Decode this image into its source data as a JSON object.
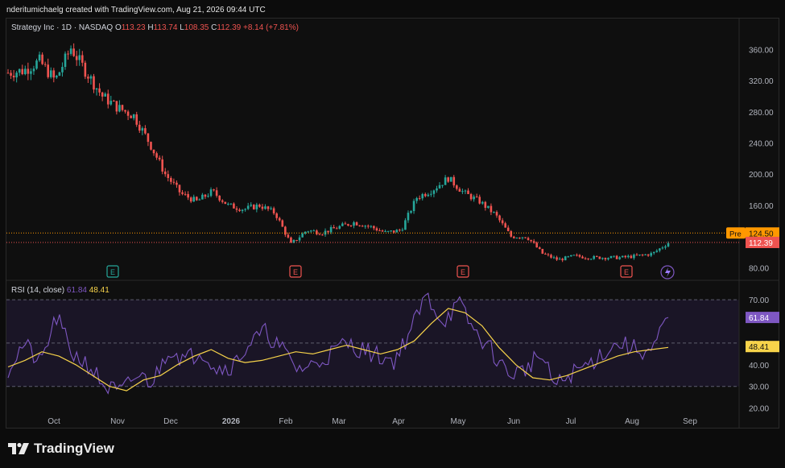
{
  "header": {
    "credit": "nderitumichaelg created with TradingView.com, Aug 21, 2026 09:44 UTC"
  },
  "legend": {
    "symbol": "Strategy Inc · 1D · NASDAQ",
    "o_label": "O",
    "o": "113.23",
    "h_label": "H",
    "h": "113.74",
    "l_label": "L",
    "l": "108.35",
    "c_label": "C",
    "c": "112.39",
    "change": "+8.14 (+7.81%)",
    "rsi_label": "RSI (14, close)",
    "rsi_value": "61.84",
    "rsi_ma": "48.41"
  },
  "price_axis": {
    "ticks": [
      "360.00",
      "320.00",
      "280.00",
      "240.00",
      "200.00",
      "160.00",
      "80.00"
    ]
  },
  "price_tags": {
    "pre_label": "Pre",
    "pre_value": "124.50",
    "last_value": "112.39"
  },
  "rsi_axis": {
    "ticks": [
      "70.00",
      "50.00",
      "40.00",
      "30.00",
      "20.00"
    ],
    "rsi_tag": "61.84",
    "ma_tag": "48.41"
  },
  "x_axis": {
    "ticks": [
      "Oct",
      "Nov",
      "Dec",
      "2026",
      "Feb",
      "Mar",
      "Apr",
      "May",
      "Jun",
      "Jul",
      "Aug",
      "Sep"
    ]
  },
  "events": {
    "label": "E"
  },
  "colors": {
    "up": "#26a69a",
    "down": "#ef5350",
    "rsi": "#7e57c2",
    "rsi_ma": "#f7d34a",
    "pre": "#ff9800"
  },
  "chart_data": {
    "type": "candlestick",
    "title": "Strategy Inc · 1D · NASDAQ",
    "ylim": [
      70,
      380
    ],
    "price_anchors_x": [
      "Sep 12",
      "Sep 20",
      "Sep 28",
      "Oct 1",
      "Oct 5",
      "Oct 12",
      "Oct 20",
      "Oct 28",
      "Nov 5",
      "Nov 12",
      "Nov 20",
      "Nov 28",
      "Dec 5",
      "Dec 15",
      "Dec 25",
      "Jan 5",
      "Jan 15",
      "Jan 25",
      "Feb 1",
      "Feb 5",
      "Feb 15",
      "Feb 25",
      "Mar 5",
      "Mar 15",
      "Mar 25",
      "Apr 1",
      "Apr 10",
      "Apr 20",
      "Apr 28",
      "May 5",
      "May 12",
      "May 20",
      "May 28",
      "Jun 5",
      "Jun 12",
      "Jun 20",
      "Jun 25",
      "Jul 5",
      "Jul 15",
      "Jul 25",
      "Aug 5",
      "Aug 15",
      "Aug 20"
    ],
    "price_anchors_y": [
      330,
      333,
      345,
      320,
      362,
      330,
      300,
      285,
      275,
      240,
      200,
      175,
      165,
      178,
      160,
      155,
      160,
      150,
      110,
      128,
      125,
      132,
      138,
      133,
      125,
      128,
      170,
      180,
      195,
      176,
      165,
      148,
      120,
      120,
      98,
      90,
      95,
      93,
      93,
      93,
      95,
      98,
      112
    ],
    "rsi": {
      "period": 14,
      "last": 61.84,
      "ma_last": 48.41,
      "ylim": [
        20,
        75
      ],
      "bands": [
        30,
        50,
        70
      ]
    },
    "rsi_anchors": [
      38,
      50,
      40,
      62,
      45,
      40,
      30,
      27,
      35,
      32,
      48,
      42,
      47,
      38,
      40,
      50,
      55,
      47,
      38,
      40,
      45,
      50,
      47,
      44,
      42,
      56,
      72,
      60,
      68,
      55,
      47,
      36,
      37,
      45,
      30,
      36,
      40,
      46,
      50,
      47,
      46,
      62
    ],
    "rsi_ma_anchors": [
      39,
      42,
      46,
      44,
      40,
      35,
      30,
      28,
      33,
      35,
      40,
      44,
      47,
      43,
      41,
      42,
      44,
      46,
      45,
      47,
      49,
      47,
      45,
      47,
      51,
      59,
      66,
      64,
      58,
      48,
      40,
      34,
      33,
      35,
      38,
      41,
      44,
      46,
      47,
      48
    ]
  }
}
